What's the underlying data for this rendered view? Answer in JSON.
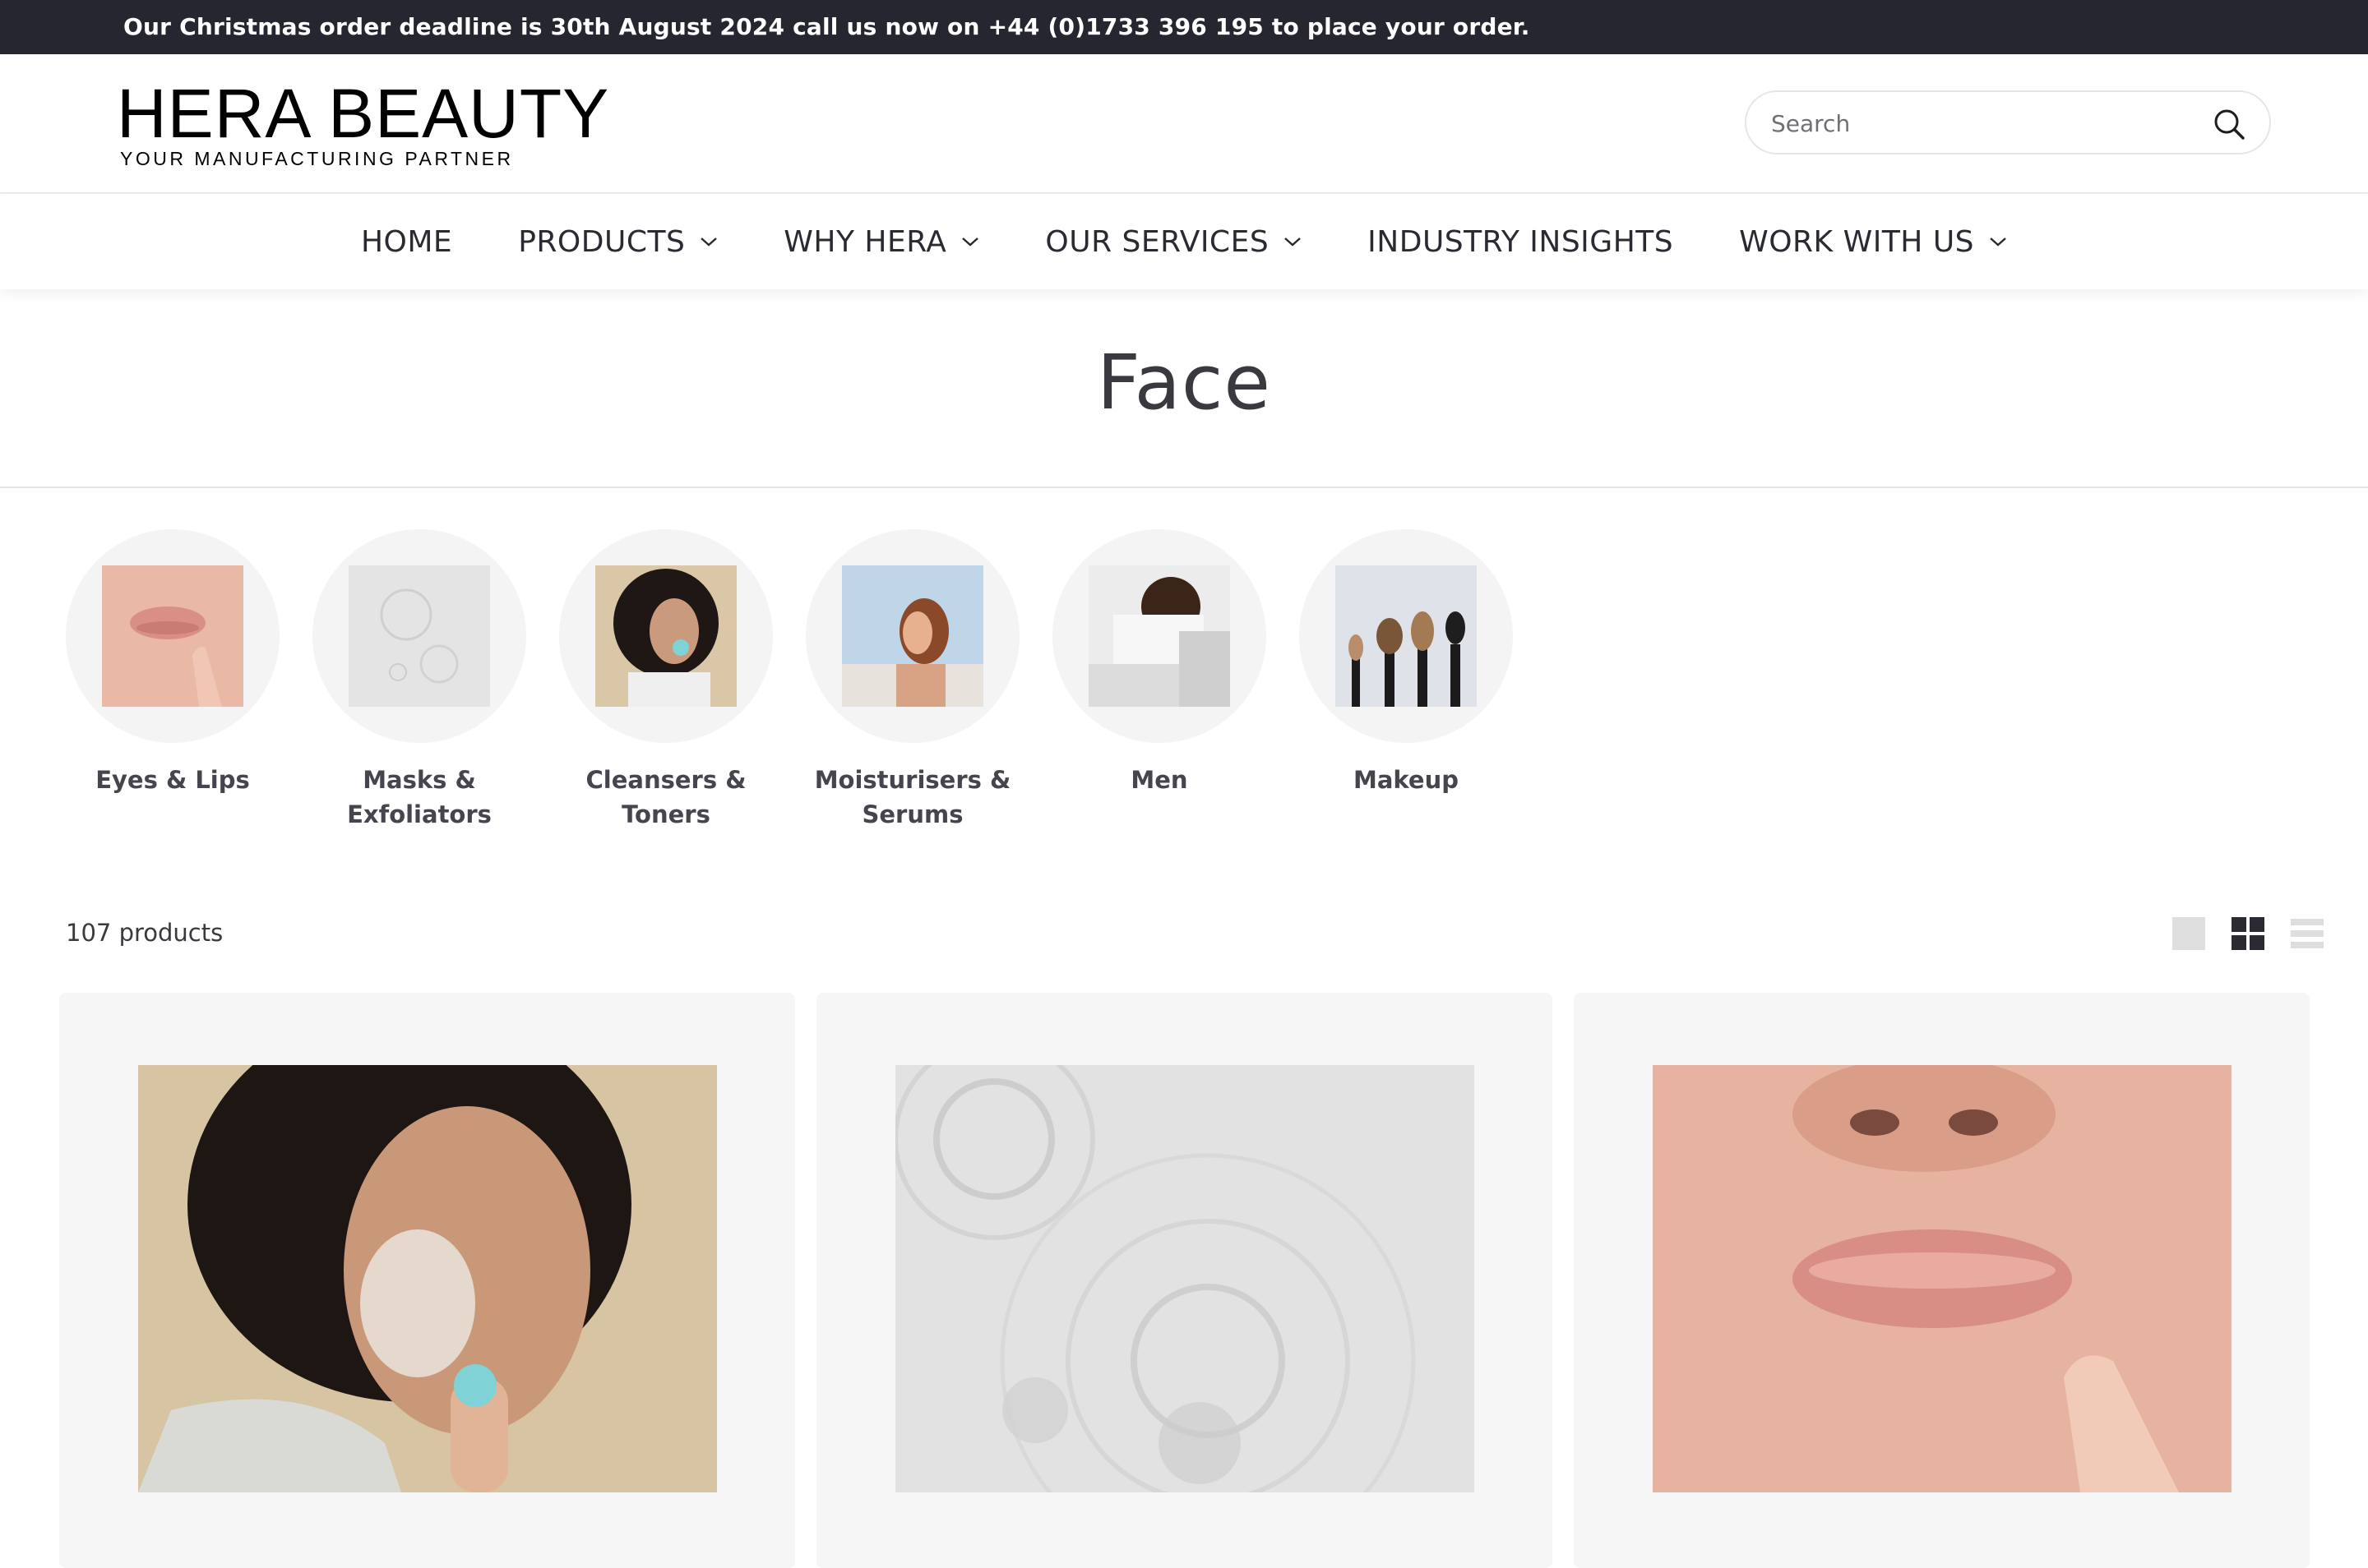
{
  "announcement": "Our Christmas order deadline is 30th August 2024 call us now on +44 (0)1733 396 195 to place your order.",
  "logo": {
    "main": "HERA BEAUTY",
    "sub": "YOUR MANUFACTURING PARTNER"
  },
  "search": {
    "placeholder": "Search",
    "icon": "search-icon"
  },
  "nav": {
    "items": [
      {
        "label": "HOME",
        "dropdown": false
      },
      {
        "label": "PRODUCTS",
        "dropdown": true
      },
      {
        "label": "WHY HERA",
        "dropdown": true
      },
      {
        "label": "OUR SERVICES",
        "dropdown": true
      },
      {
        "label": "INDUSTRY INSIGHTS",
        "dropdown": false
      },
      {
        "label": "WORK WITH US",
        "dropdown": true
      }
    ]
  },
  "page": {
    "title": "Face"
  },
  "categories": [
    {
      "label": "Eyes & Lips"
    },
    {
      "label": "Masks & Exfoliators"
    },
    {
      "label": "Cleansers & Toners"
    },
    {
      "label": "Moisturisers & Serums"
    },
    {
      "label": "Men"
    },
    {
      "label": "Makeup"
    }
  ],
  "products": {
    "count_text": "107 products"
  },
  "view_options": [
    "large-grid-icon",
    "small-grid-icon",
    "list-icon"
  ],
  "colors": {
    "announcement_bg": "#262630",
    "card_bg": "#f6f6f6",
    "text": "#2b2a33"
  }
}
